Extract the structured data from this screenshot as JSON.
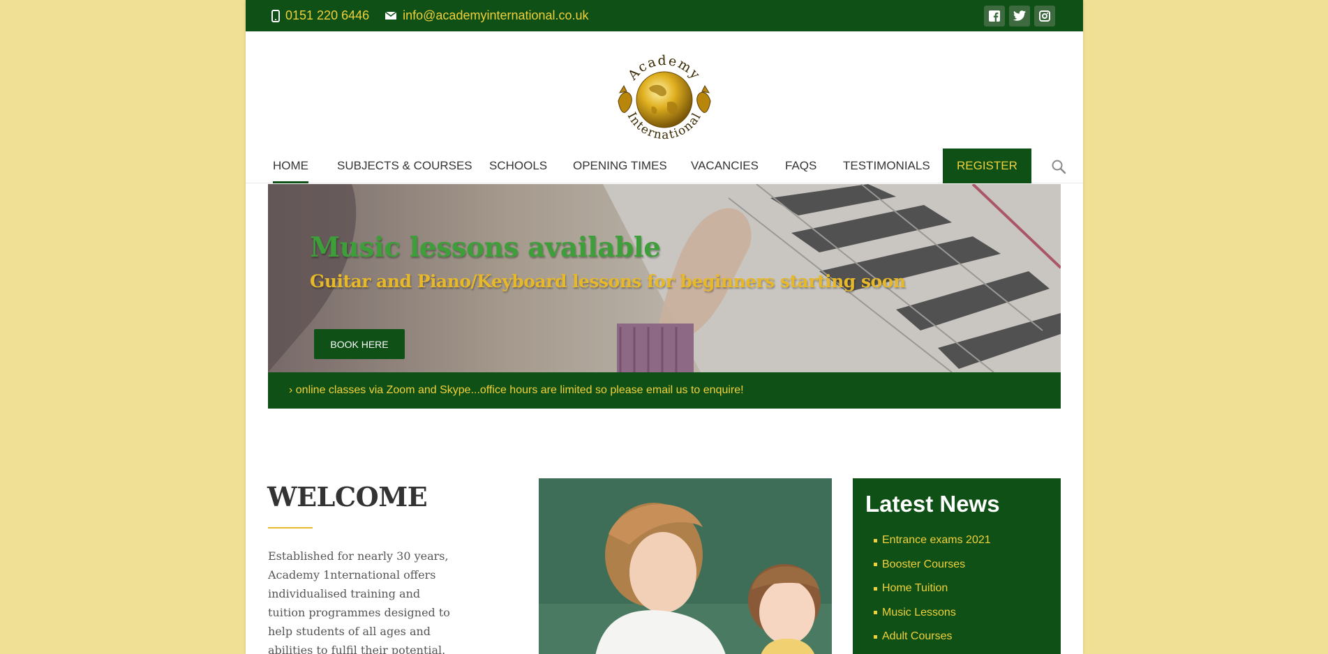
{
  "topbar": {
    "phone": "0151 220 6446",
    "email": "info@academyinternational.co.uk",
    "social": [
      "facebook-icon",
      "twitter-icon",
      "instagram-icon"
    ]
  },
  "logo": {
    "top_text": "Academy",
    "bottom_text": "International"
  },
  "nav": {
    "items": [
      "HOME",
      "SUBJECTS & COURSES",
      "SCHOOLS",
      "OPENING TIMES",
      "VACANCIES",
      "FAQS",
      "TESTIMONIALS"
    ],
    "register": "REGISTER",
    "active": "HOME"
  },
  "hero": {
    "title": "Music lessons available",
    "subtitle": "Guitar and Piano/Keyboard lessons for beginners starting soon",
    "button": "BOOK HERE"
  },
  "ticker": {
    "text": "› online classes via Zoom and Skype...office hours are limited so please email us to enquire!"
  },
  "welcome": {
    "title": "WELCOME",
    "text": "Established for nearly 30 years, Academy 1nternational offers individualised training and tuition programmes designed to help students of all ages and abilities to fulfil their potential. We have an"
  },
  "news": {
    "title": "Latest News",
    "items": [
      "Entrance exams 2021",
      "Booster Courses",
      "Home Tuition",
      "Music Lessons",
      "Adult Courses"
    ]
  },
  "colors": {
    "brand_green": "#0e5015",
    "accent_yellow": "#f2d03b",
    "page_bg": "#f0e096"
  }
}
